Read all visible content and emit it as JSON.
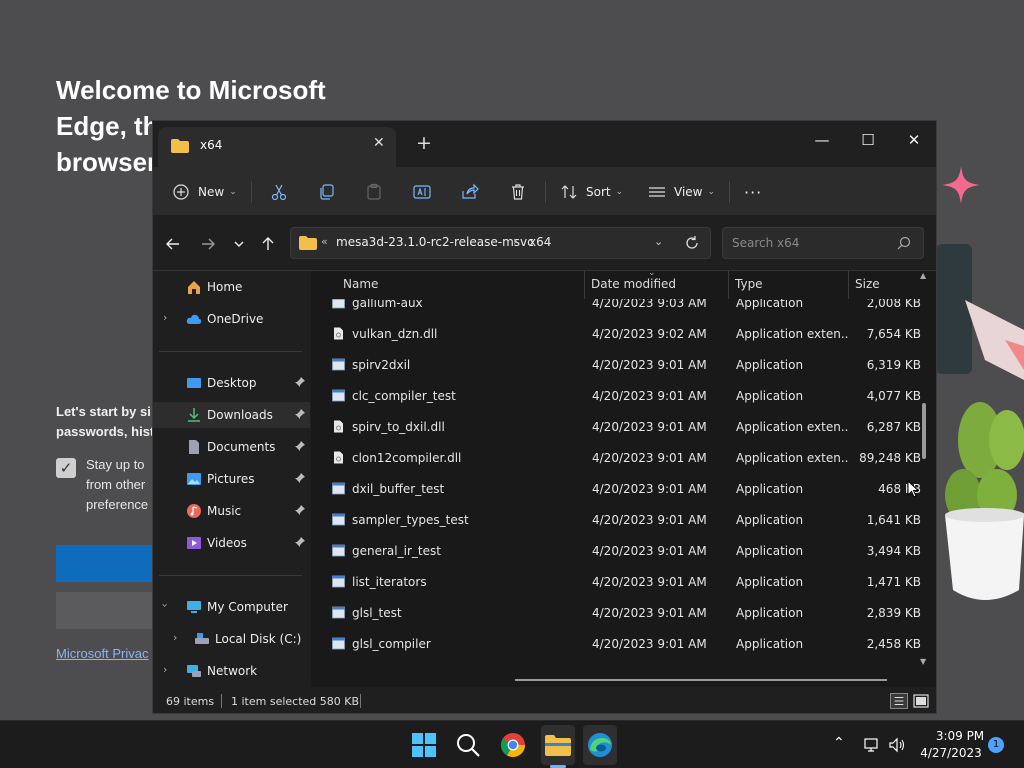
{
  "edge": {
    "title": "Welcome to Microsoft Edge, the best … for your browser",
    "title_visible_1": "Welcome to Microsoft",
    "title_visible_2": "Edge, th",
    "title_visible_3": "browser",
    "subtitle": "Let's start by si",
    "subtitle2": "passwords, hist",
    "check_text_1": "Stay up to",
    "check_text_2": "from other",
    "check_text_3": "preference",
    "link": "Microsoft Privac"
  },
  "window": {
    "tab_title": "x64",
    "controls": {
      "minimize": "—",
      "maximize": "☐",
      "close": "✕"
    }
  },
  "toolbar": {
    "new_label": "New",
    "sort_label": "Sort",
    "view_label": "View",
    "more_label": "···"
  },
  "address": {
    "chevron": "«",
    "segment1": "mesa3d-23.1.0-rc2-release-msvc",
    "separator": "›",
    "segment2": "x64",
    "search_placeholder": "Search x64"
  },
  "nav": {
    "home": "Home",
    "onedrive": "OneDrive",
    "desktop": "Desktop",
    "downloads": "Downloads",
    "documents": "Documents",
    "pictures": "Pictures",
    "music": "Music",
    "videos": "Videos",
    "mycomputer": "My Computer",
    "localdisk": "Local Disk (C:)",
    "network": "Network"
  },
  "columns": {
    "name": "Name",
    "date": "Date modified",
    "type": "Type",
    "size": "Size"
  },
  "files": [
    {
      "name": "gallium-aux",
      "date": "4/20/2023 9:03 AM",
      "type": "Application",
      "size": "2,008 KB"
    },
    {
      "name": "vulkan_dzn.dll",
      "date": "4/20/2023 9:02 AM",
      "type": "Application exten...",
      "size": "7,654 KB"
    },
    {
      "name": "spirv2dxil",
      "date": "4/20/2023 9:01 AM",
      "type": "Application",
      "size": "6,319 KB"
    },
    {
      "name": "clc_compiler_test",
      "date": "4/20/2023 9:01 AM",
      "type": "Application",
      "size": "4,077 KB"
    },
    {
      "name": "spirv_to_dxil.dll",
      "date": "4/20/2023 9:01 AM",
      "type": "Application exten...",
      "size": "6,287 KB"
    },
    {
      "name": "clon12compiler.dll",
      "date": "4/20/2023 9:01 AM",
      "type": "Application exten...",
      "size": "89,248 KB"
    },
    {
      "name": "dxil_buffer_test",
      "date": "4/20/2023 9:01 AM",
      "type": "Application",
      "size": "468 KB"
    },
    {
      "name": "sampler_types_test",
      "date": "4/20/2023 9:01 AM",
      "type": "Application",
      "size": "1,641 KB"
    },
    {
      "name": "general_ir_test",
      "date": "4/20/2023 9:01 AM",
      "type": "Application",
      "size": "3,494 KB"
    },
    {
      "name": "list_iterators",
      "date": "4/20/2023 9:01 AM",
      "type": "Application",
      "size": "1,471 KB"
    },
    {
      "name": "glsl_test",
      "date": "4/20/2023 9:01 AM",
      "type": "Application",
      "size": "2,839 KB"
    },
    {
      "name": "glsl_compiler",
      "date": "4/20/2023 9:01 AM",
      "type": "Application",
      "size": "2,458 KB"
    }
  ],
  "status": {
    "count": "69 items",
    "selected": "1 item selected  580 KB"
  },
  "taskbar": {
    "time": "3:09 PM",
    "date": "4/27/2023",
    "notifications": "1"
  },
  "colors": {
    "accent": "#0f6cbd",
    "folder": "#f2c04a",
    "window_bg": "#191919"
  }
}
